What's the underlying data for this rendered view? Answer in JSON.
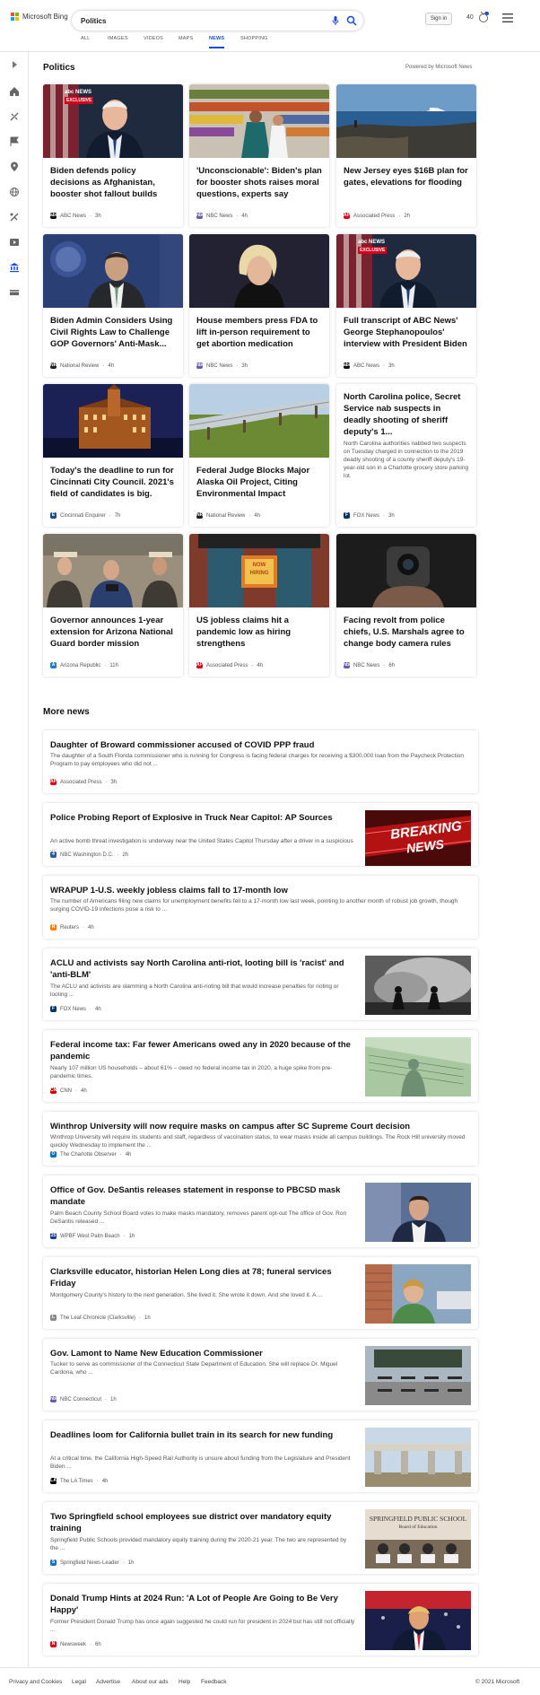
{
  "header": {
    "brand": "Microsoft Bing",
    "search_value": "Politics",
    "signin": "Sign in",
    "points": "40",
    "tabs": [
      "ALL",
      "IMAGES",
      "VIDEOS",
      "MAPS",
      "NEWS",
      "SHOPPING"
    ],
    "active_tab": "NEWS",
    "colors": {
      "accent": "#174ae4",
      "ms_red": "#f25022",
      "ms_green": "#7fba00",
      "ms_blue": "#00a4ef",
      "ms_yellow": "#ffb900"
    }
  },
  "sidebar": {
    "icons": [
      "expand-icon",
      "home-icon",
      "sports-icon",
      "flag-icon",
      "location-icon",
      "globe-icon",
      "science-icon",
      "entertainment-icon",
      "politics-icon",
      "money-icon"
    ]
  },
  "section": {
    "title": "Politics",
    "powered_by": "Powered by Microsoft News"
  },
  "cards": [
    {
      "title": "Biden defends policy decisions as Afghanistan, booster shot fallout builds",
      "source": "ABC News",
      "age": "3h",
      "fav": "abc",
      "fav_color": "#111",
      "image": "biden-exclusive"
    },
    {
      "title": "'Unconscionable': Biden's plan for booster shots raises moral questions, experts say",
      "source": "NBC News",
      "age": "4h",
      "fav": "nbc",
      "fav_color": "#6460aa",
      "image": "vaccine-grocery"
    },
    {
      "title": "New Jersey eyes $16B plan for gates, elevations for flooding",
      "source": "Associated Press",
      "age": "2h",
      "fav": "AP",
      "fav_color": "#e2001a",
      "image": "coast-boat"
    },
    {
      "title": "Biden Admin Considers Using Civil Rights Law to Challenge GOP Governors' Anti-Mask...",
      "source": "National Review",
      "age": "4h",
      "fav": "NR",
      "fav_color": "#222",
      "image": "press-briefing"
    },
    {
      "title": "House members press FDA to lift in-person requirement to get abortion medication",
      "source": "NBC News",
      "age": "3h",
      "fav": "nbc",
      "fav_color": "#6460aa",
      "image": "congresswoman"
    },
    {
      "title": "Full transcript of ABC News' George Stephanopoulos' interview with President Biden",
      "source": "ABC News",
      "age": "3h",
      "fav": "abc",
      "fav_color": "#111",
      "image": "biden-exclusive"
    },
    {
      "title": "Today's the deadline to run for Cincinnati City Council. 2021's field of candidates is big.",
      "source": "Cincinnati Enquirer",
      "age": "7h",
      "fav": "E",
      "fav_color": "#1b4b8a",
      "image": "city-hall-night"
    },
    {
      "title": "Federal Judge Blocks Major Alaska Oil Project, Citing Environmental Impact",
      "source": "National Review",
      "age": "4h",
      "fav": "NR",
      "fav_color": "#222",
      "image": "pipeline"
    },
    {
      "title": "North Carolina police, Secret Service nab suspects in deadly shooting of sheriff deputy's 1...",
      "desc": "North Carolina authorities nabbed two suspects on Tuesday charged in connection to the 2019 deadly shooting of a county sheriff deputy's 19-year-old son in a Charlotte grocery store parking lot.",
      "source": "FOX News",
      "age": "3h",
      "fav": "F",
      "fav_color": "#003366",
      "image": ""
    },
    {
      "title": "Governor announces 1-year extension for Arizona National Guard border mission",
      "source": "Arizona Republic",
      "age": "11h",
      "fav": "A",
      "fav_color": "#2a7ab9",
      "image": "governor-press"
    },
    {
      "title": "US jobless claims hit a pandemic low as hiring strengthens",
      "source": "Associated Press",
      "age": "4h",
      "fav": "AP",
      "fav_color": "#e2001a",
      "image": "store-hiring"
    },
    {
      "title": "Facing revolt from police chiefs, U.S. Marshals agree to change body camera rules",
      "source": "NBC News",
      "age": "6h",
      "fav": "nbc",
      "fav_color": "#6460aa",
      "image": "body-camera"
    }
  ],
  "more_news": {
    "title": "More news",
    "items": [
      {
        "title": "Daughter of Broward commissioner accused of COVID PPP fraud",
        "desc": "The daughter of a South Florida commissioner who is running for Congress is facing federal charges for receiving a $300,000 loan from the Paycheck Protection Program to pay employees who did not ...",
        "source": "Associated Press",
        "age": "3h",
        "fav": "AP",
        "fav_color": "#e2001a",
        "thumb": ""
      },
      {
        "title": "Police Probing Report of Explosive in Truck Near Capitol: AP Sources",
        "desc": "An active bomb threat investigation is underway near the United States Capitol Thursday after a driver in a suspicious ...",
        "source": "NBC Washington D.C.",
        "age": "2h",
        "fav": "4",
        "fav_color": "#2c5aa0",
        "thumb": "breaking-news"
      },
      {
        "title": "WRAPUP 1-U.S. weekly jobless claims fall to 17-month low",
        "desc": "The number of Americans filing new claims for unemployment benefits fell to a 17-month low last week, pointing to another month of robust job growth, though surging COVID-19 infections pose a risk to ...",
        "source": "Reuters",
        "age": "4h",
        "fav": "R",
        "fav_color": "#ff8000",
        "thumb": ""
      },
      {
        "title": "ACLU and activists say North Carolina anti-riot, looting bill is 'racist' and 'anti-BLM'",
        "desc": "The ACLU and activists are slamming a North Carolina anti-rioting bill that would increase penalties for rioting or looting ...",
        "source": "FOX News",
        "age": "4h",
        "fav": "F",
        "fav_color": "#003366",
        "thumb": "riot-smoke"
      },
      {
        "title": "Federal income tax: Far fewer Americans owed any in 2020 because of the pandemic",
        "desc": "Nearly 107 million US households – about 61% – owed no federal income tax in 2020, a huge spike from pre-pandemic times.",
        "source": "CNN",
        "age": "4h",
        "fav": "CNN",
        "fav_color": "#cc0000",
        "thumb": "tax-check"
      },
      {
        "title": "Winthrop University will now require masks on campus after SC Supreme Court decision",
        "desc": "Winthrop University will require its students and staff, regardless of vaccination status, to wear masks inside all campus buildings. The Rock Hill university moved quickly Wednesday to implement the ...",
        "source": "The Charlotte Observer",
        "age": "4h",
        "fav": "O",
        "fav_color": "#0072bc",
        "thumb": ""
      },
      {
        "title": "Office of Gov. DeSantis releases statement in response to PBCSD mask mandate",
        "desc": "Palm Beach County School Board votes to make masks mandatory, removes parent opt-out The office of Gov. Ron DeSantis released ...",
        "source": "WPBF West Palm Beach",
        "age": "1h",
        "fav": "25",
        "fav_color": "#1a3a8f",
        "thumb": "desantis"
      },
      {
        "title": "Clarksville educator, historian Helen Long dies at 78; funeral services Friday",
        "desc": "Montgomery County's history to the next generation. She lived it. She wrote it down. And she loved it.  A ...",
        "source": "The Leaf-Chronicle (Clarksville)",
        "age": "1h",
        "fav": "L",
        "fav_color": "#888",
        "thumb": "helen-long"
      },
      {
        "title": "Gov. Lamont to Name New Education Commissioner",
        "desc": "Tucker to serve as commissioner of the Connecticut State Department of Education. She will replace Dr. Miguel Cardona, who ...",
        "source": "NBC Connecticut",
        "age": "1h",
        "fav": "nbc",
        "fav_color": "#6460aa",
        "thumb": "classroom"
      },
      {
        "title": "Deadlines loom for California bullet train in its search for new funding",
        "desc": "At a critical time, the California High-Speed Rail Authority is unsure about funding from the Legislature and President Biden ...",
        "source": "The LA Times",
        "age": "4h",
        "fav": "LA",
        "fav_color": "#000",
        "thumb": "rail-viaduct"
      },
      {
        "title": "Two Springfield school employees sue district over mandatory equity training",
        "desc": "Springfield Public Schools provided mandatory equity training during the 2020-21 year. The two are represented by the ...",
        "source": "Springfield News-Leader",
        "age": "1h",
        "fav": "S",
        "fav_color": "#1b6fb5",
        "thumb": "springfield-board"
      },
      {
        "title": "Donald Trump Hints at 2024 Run: 'A Lot of People Are Going to Be Very Happy'",
        "desc": "Former President Donald Trump has once again suggested he could run for president in 2024 but has still not officially ...",
        "source": "Newsweek",
        "age": "6h",
        "fav": "N",
        "fav_color": "#e2001a",
        "thumb": "trump-rally"
      }
    ],
    "springfield_sign": [
      "SPRINGFIELD PUBLIC SCHOOL",
      "Board of Education"
    ],
    "breaking_text": [
      "BREAKING",
      "NEWS"
    ],
    "exclusive_label": "EXCLUSIVE",
    "abc_label": "abc NEWS",
    "store_sign": [
      "NOW",
      "HIRING"
    ]
  },
  "footer": {
    "links": [
      "Privacy and Cookies",
      "Legal",
      "Advertise",
      "About our ads",
      "Help",
      "Feedback"
    ],
    "copyright": "© 2021 Microsoft"
  }
}
